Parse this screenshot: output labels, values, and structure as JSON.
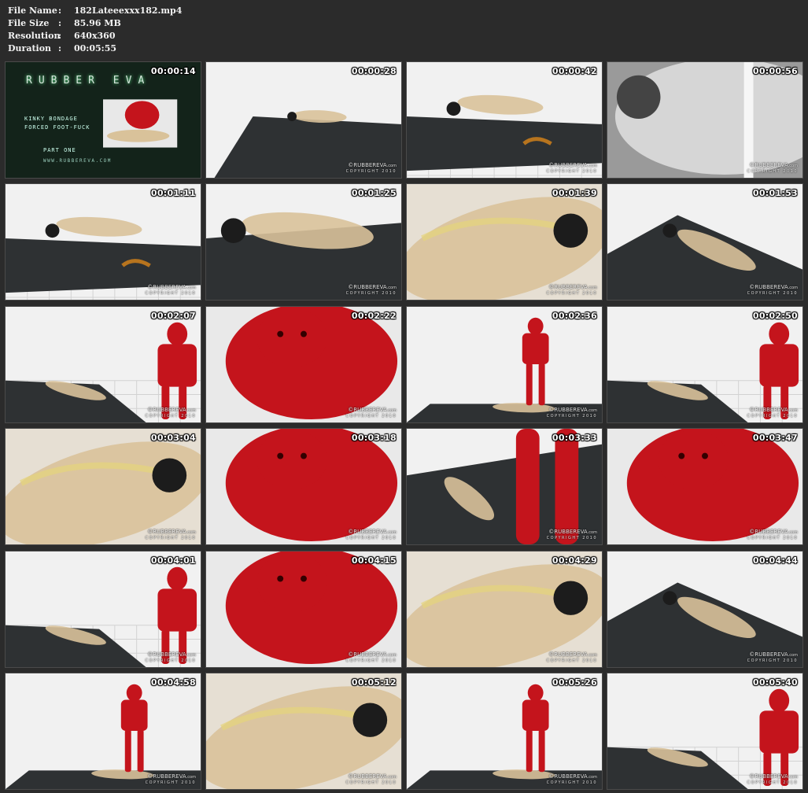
{
  "header": {
    "rows": [
      {
        "label": "File Name",
        "sep": ":",
        "value": "182Lateeexxx182.mp4"
      },
      {
        "label": "File Size",
        "sep": ":",
        "value": "85.96 MB"
      },
      {
        "label": "Resolution",
        "sep": ":",
        "value": "640x360"
      },
      {
        "label": "Duration",
        "sep": ":",
        "value": "00:05:55"
      }
    ]
  },
  "title_card": {
    "brand": "RUBBER EVA",
    "lines": [
      "KINKY BONDAGE",
      "FORCED FOOT-FUCK",
      "PART ONE"
    ],
    "url": "WWW.RUBBEREVA.COM"
  },
  "watermark": {
    "brand": "©RUBBEREVA",
    "suffix": ".com",
    "copyright": "COPYRIGHT 2010"
  },
  "thumbnails": [
    {
      "time": "00:00:14",
      "scene": "title"
    },
    {
      "time": "00:00:28",
      "scene": "floor-wide"
    },
    {
      "time": "00:00:42",
      "scene": "floor-mid"
    },
    {
      "time": "00:00:56",
      "scene": "closeup-bw"
    },
    {
      "time": "00:01:11",
      "scene": "floor-mid"
    },
    {
      "time": "00:01:25",
      "scene": "floor-close"
    },
    {
      "time": "00:01:39",
      "scene": "body-close"
    },
    {
      "time": "00:01:53",
      "scene": "floor-diag"
    },
    {
      "time": "00:02:07",
      "scene": "red-stand"
    },
    {
      "time": "00:02:22",
      "scene": "red-close"
    },
    {
      "time": "00:02:36",
      "scene": "red-stand-wide"
    },
    {
      "time": "00:02:50",
      "scene": "red-stand"
    },
    {
      "time": "00:03:04",
      "scene": "body-close"
    },
    {
      "time": "00:03:18",
      "scene": "red-close"
    },
    {
      "time": "00:03:33",
      "scene": "red-legs"
    },
    {
      "time": "00:03:47",
      "scene": "red-close"
    },
    {
      "time": "00:04:01",
      "scene": "red-stand"
    },
    {
      "time": "00:04:15",
      "scene": "red-close"
    },
    {
      "time": "00:04:29",
      "scene": "body-close"
    },
    {
      "time": "00:04:44",
      "scene": "floor-diag"
    },
    {
      "time": "00:04:58",
      "scene": "red-stand-wide"
    },
    {
      "time": "00:05:12",
      "scene": "body-close"
    },
    {
      "time": "00:05:26",
      "scene": "red-stand-wide"
    },
    {
      "time": "00:05:40",
      "scene": "red-stand"
    }
  ]
}
